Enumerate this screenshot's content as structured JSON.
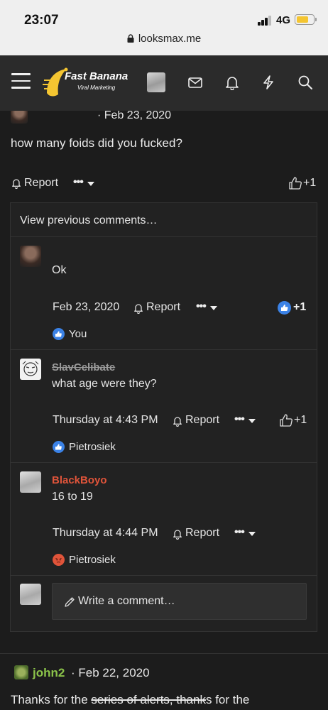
{
  "statusbar": {
    "time": "23:07",
    "network": "4G",
    "battery_level": 0.7,
    "url": "looksmax.me"
  },
  "header": {
    "logo_title": "Fast Banana",
    "logo_subtitle": "Viral Marketing",
    "icons": [
      "menu-icon",
      "avatar",
      "mail-icon",
      "bell-icon",
      "bolt-icon",
      "search-icon"
    ]
  },
  "post": {
    "date_text": "· Feb 23, 2020",
    "body": "how many foids did you fucked?",
    "report_label": "Report",
    "like_count": "+1"
  },
  "comments": {
    "view_previous": "View previous comments…",
    "items": [
      {
        "author": "",
        "text": "Ok",
        "date": "Feb 23, 2020",
        "report_label": "Report",
        "like_count": "+1",
        "reactor": "You"
      },
      {
        "author": "SlavCelibate",
        "text": "what age were they?",
        "date": "Thursday at 4:43 PM",
        "report_label": "Report",
        "like_count": "+1",
        "reactor": "Pietrosiek"
      },
      {
        "author": "BlackBoyo",
        "text": "16 to 19",
        "date": "Thursday at 4:44 PM",
        "report_label": "Report",
        "reactor": "Pietrosiek"
      }
    ],
    "write_placeholder": "Write a comment…"
  },
  "next_post": {
    "author": "john2",
    "date_text": "· Feb 22, 2020",
    "body_start": "Thanks for the ",
    "body_struck": "series of alerts, thank",
    "body_end": "s for the"
  },
  "colors": {
    "accent_blue": "#3b82e6",
    "author_red": "#e0543a",
    "author_green": "#8bc34a",
    "struck_author": "#9a9a9a"
  }
}
